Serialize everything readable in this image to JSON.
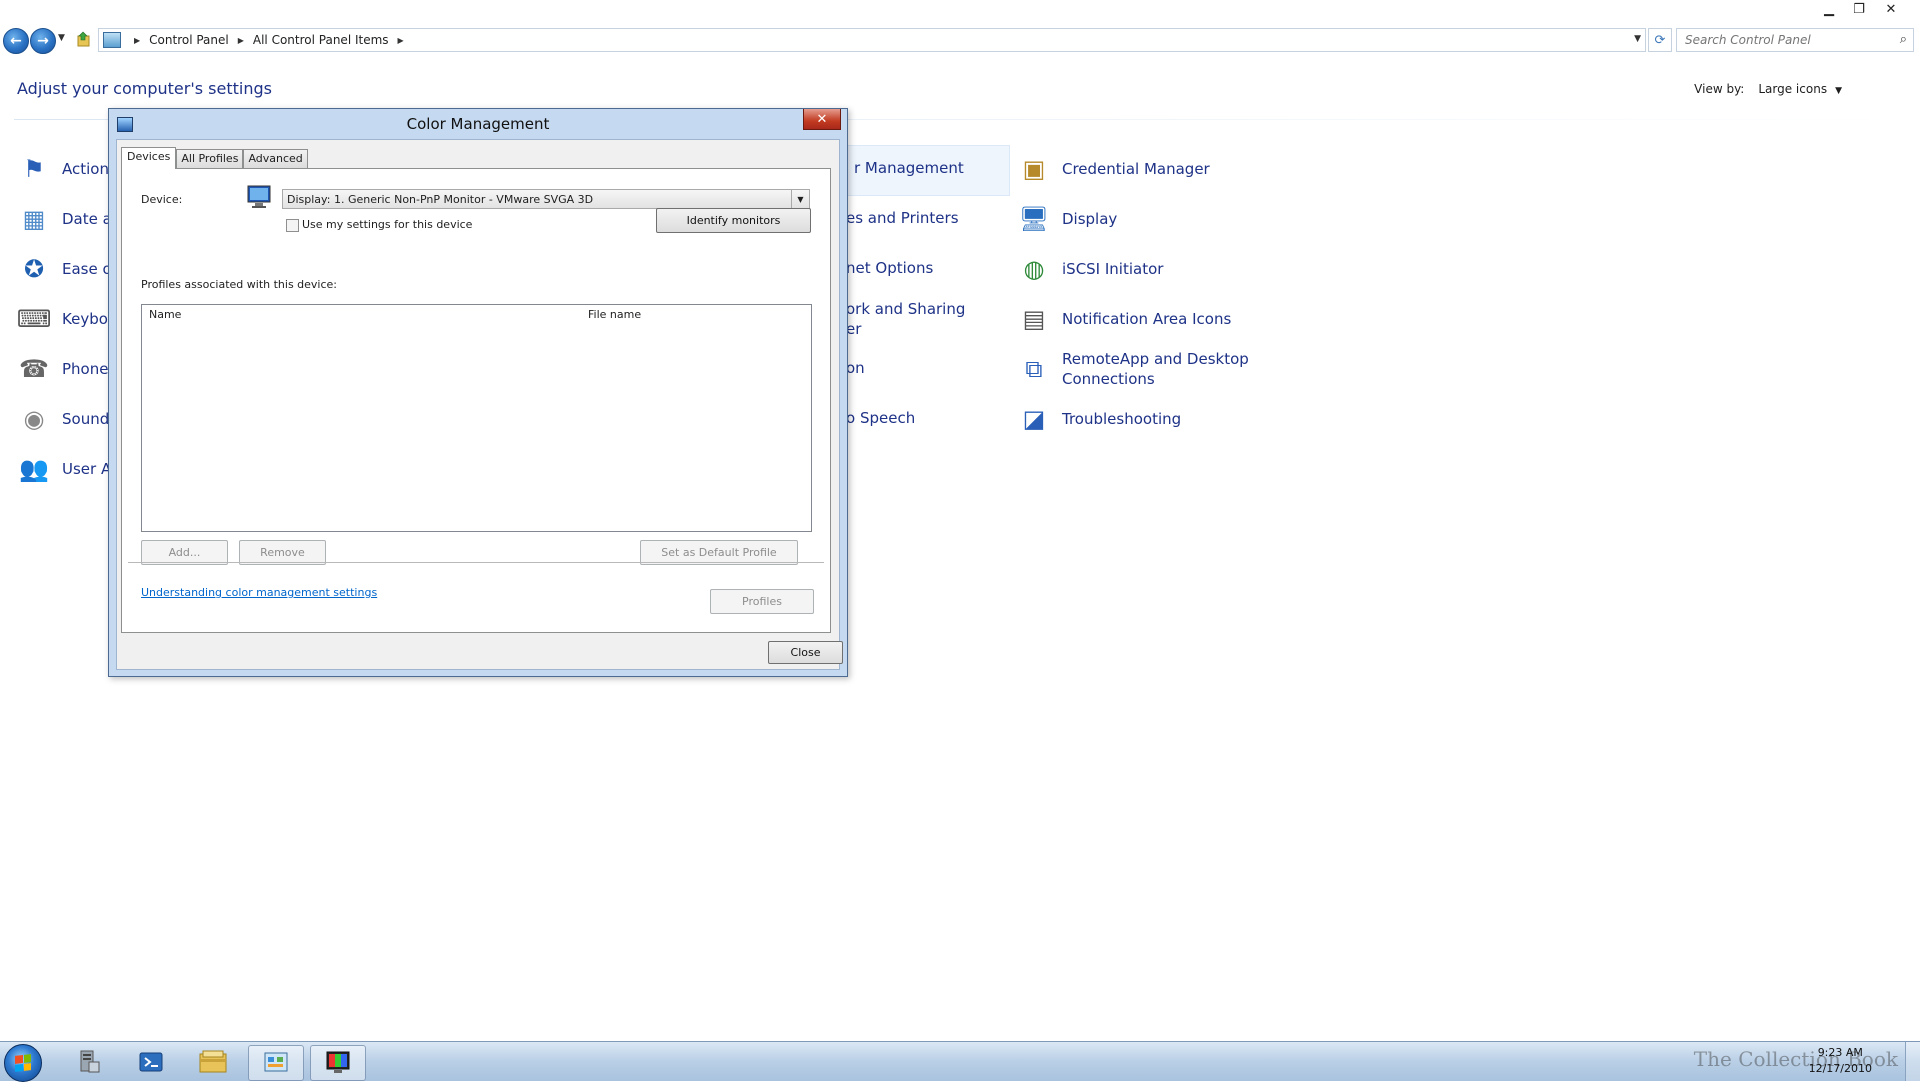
{
  "window": {
    "minimize": "▁",
    "maximize": "❐",
    "close": "✕"
  },
  "address_bar": {
    "crumbs": [
      "Control Panel",
      "All Control Panel Items"
    ],
    "search_placeholder": "Search Control Panel"
  },
  "header": {
    "title": "Adjust your computer's settings",
    "view_by_label": "View by:",
    "view_by_value": "Large icons"
  },
  "left_items": [
    {
      "label": "Action",
      "icon": "flag-icon"
    },
    {
      "label": "Date a",
      "icon": "calendar-icon"
    },
    {
      "label": "Ease o",
      "icon": "ease-of-access-icon"
    },
    {
      "label": "Keybo",
      "icon": "keyboard-icon"
    },
    {
      "label": "Phone",
      "icon": "phone-icon"
    },
    {
      "label": "Sound",
      "icon": "speaker-icon"
    },
    {
      "label": "User A",
      "icon": "users-icon"
    }
  ],
  "middle_items": [
    {
      "label": "r Management"
    },
    {
      "label": "es and Printers"
    },
    {
      "label": "net Options"
    },
    {
      "label": "ork and Sharing\ner"
    },
    {
      "label": "on"
    },
    {
      "label": "o Speech"
    }
  ],
  "right_items": [
    {
      "label": "Credential Manager",
      "icon": "vault-icon"
    },
    {
      "label": "Display",
      "icon": "monitor-icon"
    },
    {
      "label": "iSCSI Initiator",
      "icon": "globe-icon"
    },
    {
      "label": "Notification Area Icons",
      "icon": "notification-icon"
    },
    {
      "label": "RemoteApp and Desktop\nConnections",
      "icon": "remote-desktop-icon"
    },
    {
      "label": "Troubleshooting",
      "icon": "troubleshoot-icon"
    }
  ],
  "dialog": {
    "title": "Color Management",
    "close_glyph": "✕",
    "tabs": [
      "Devices",
      "All Profiles",
      "Advanced"
    ],
    "device_label": "Device:",
    "device_value": "Display: 1. Generic Non-PnP Monitor - VMware SVGA 3D",
    "use_my_settings": "Use my settings for this device",
    "identify_monitors": "Identify monitors",
    "profiles_label": "Profiles associated with this device:",
    "columns": [
      "Name",
      "File name"
    ],
    "add": "Add...",
    "remove": "Remove",
    "set_default": "Set as Default Profile",
    "link": "Understanding color management settings",
    "profiles": "Profiles",
    "close": "Close"
  },
  "taskbar": {
    "time": "9:23 AM",
    "date": "12/17/2010",
    "watermark": "The Collection Book"
  },
  "colors": {
    "link_blue": "#1e3287",
    "dialog_frame": "#c5d9f0",
    "close_red": "#c23b21"
  }
}
